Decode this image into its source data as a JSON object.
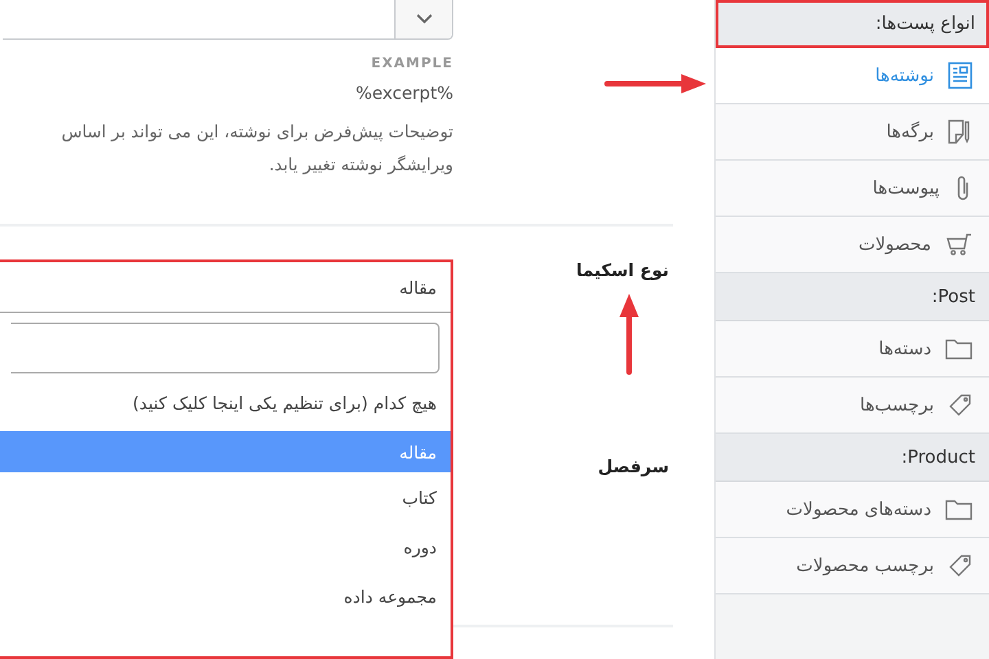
{
  "excerpt_field": {
    "example_label": "EXAMPLE",
    "example_value": "%excerpt%",
    "description": [
      "توضیحات پیش‌فرض برای نوشته، این می تواند بر اساس",
      "ویرایشگر نوشته تغییر یابد."
    ]
  },
  "schema_type": {
    "label": "نوع اسکیما",
    "value": "مقاله",
    "none_option": "هیچ کدام (برای تنظیم یکی اینجا کلیک کنید)",
    "options": [
      {
        "label": "مقاله",
        "selected": true
      },
      {
        "label": "کتاب",
        "selected": false
      },
      {
        "label": "دوره",
        "selected": false
      },
      {
        "label": "مجموعه داده",
        "selected": false
      }
    ]
  },
  "section_label": "سرفصل",
  "sidebar": {
    "sections": [
      {
        "title": "انواع پست‌ها:",
        "highlighted": true,
        "items": [
          {
            "label": "نوشته‌ها",
            "kind": "document",
            "selected": true
          },
          {
            "label": "برگه‌ها",
            "kind": "page",
            "selected": false
          },
          {
            "label": "پیوست‌ها",
            "kind": "attachment",
            "selected": false
          },
          {
            "label": "محصولات",
            "kind": "cart",
            "selected": false
          }
        ]
      },
      {
        "title": "Post:",
        "highlighted": false,
        "items": [
          {
            "label": "دسته‌ها",
            "kind": "folder",
            "selected": false
          },
          {
            "label": "برچسب‌ها",
            "kind": "tag",
            "selected": false
          }
        ]
      },
      {
        "title": "Product:",
        "highlighted": false,
        "items": [
          {
            "label": "دسته‌های محصولات",
            "kind": "folder",
            "selected": false
          },
          {
            "label": "برچسب محصولات",
            "kind": "tag",
            "selected": false
          }
        ]
      }
    ]
  }
}
